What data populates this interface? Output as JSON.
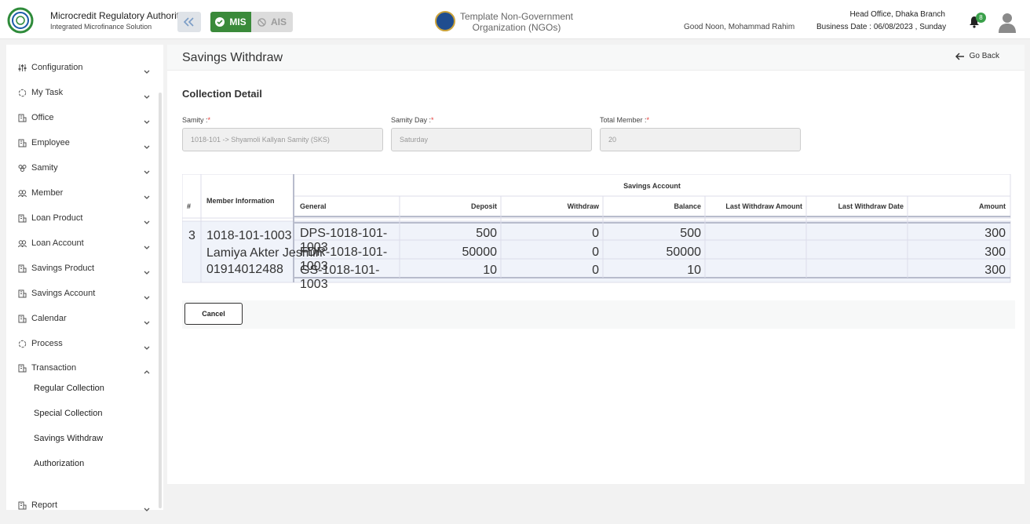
{
  "header": {
    "org_name": "Microcredit Regulatory Authority",
    "org_sub": "Integrated Microfinance Solution",
    "logo_text": "Microcredit Regulatory Authority",
    "mis_label": "MIS",
    "ais_label": "AIS",
    "center_org_line1": "Template Non-Government",
    "center_org_line2": "Organization (NGOs)",
    "greeting": "Good Noon, Mohammad Rahim",
    "branch": "Head Office, Dhaka Branch",
    "business_date": "Business Date : 06/08/2023 , Sunday",
    "notification_count": "8",
    "accent_green": "#3a8a3a"
  },
  "sidebar": {
    "items": [
      {
        "label": "Configuration",
        "icon": "sliders-icon"
      },
      {
        "label": "My Task",
        "icon": "circle-icon"
      },
      {
        "label": "Office",
        "icon": "building-icon"
      },
      {
        "label": "Employee",
        "icon": "building-icon"
      },
      {
        "label": "Samity",
        "icon": "group-icon"
      },
      {
        "label": "Member",
        "icon": "members-icon"
      },
      {
        "label": "Loan Product",
        "icon": "building-icon"
      },
      {
        "label": "Loan Account",
        "icon": "members-icon"
      },
      {
        "label": "Savings Product",
        "icon": "building-icon"
      },
      {
        "label": "Savings Account",
        "icon": "building-icon"
      },
      {
        "label": "Calendar",
        "icon": "building-icon"
      },
      {
        "label": "Process",
        "icon": "circle-icon"
      },
      {
        "label": "Transaction",
        "icon": "building-icon"
      },
      {
        "label": "Report",
        "icon": "building-icon"
      }
    ],
    "transaction_sub": [
      "Regular Collection",
      "Special Collection",
      "Savings Withdraw",
      "Authorization"
    ]
  },
  "main": {
    "page_title": "Savings Withdraw",
    "go_back": "Go Back",
    "section_title": "Collection Detail",
    "fields": {
      "samity_label": "Samity :",
      "samity_value": "1018-101 -> Shyamoli Kallyan Samity (SKS)",
      "samity_day_label": "Samity Day :",
      "samity_day_value": "Saturday",
      "total_member_label": "Total Member :",
      "total_member_value": "20",
      "required_mark": "*"
    },
    "table": {
      "col_hash": "#",
      "col_member_info": "Member Information",
      "col_group": "Savings Account",
      "sub_headers": [
        "General",
        "Deposit",
        "Withdraw",
        "Balance",
        "Last Withdraw Amount",
        "Last Withdraw Date",
        "Amount"
      ],
      "member": {
        "index": "3",
        "code": "1018-101-1003",
        "name": "Lamiya Akter Jesmin",
        "phone": "01914012488"
      },
      "rows": [
        {
          "general": "DPS-1018-101-1003",
          "deposit": "500",
          "withdraw": "0",
          "balance": "500",
          "last_amount": "",
          "last_date": "",
          "amount": "300"
        },
        {
          "general": "FDR-1018-101-1003",
          "deposit": "50000",
          "withdraw": "0",
          "balance": "50000",
          "last_amount": "",
          "last_date": "",
          "amount": "300"
        },
        {
          "general": "GS-1018-101-1003",
          "deposit": "10",
          "withdraw": "0",
          "balance": "10",
          "last_amount": "",
          "last_date": "",
          "amount": "300"
        }
      ]
    },
    "cancel_label": "Cancel"
  }
}
